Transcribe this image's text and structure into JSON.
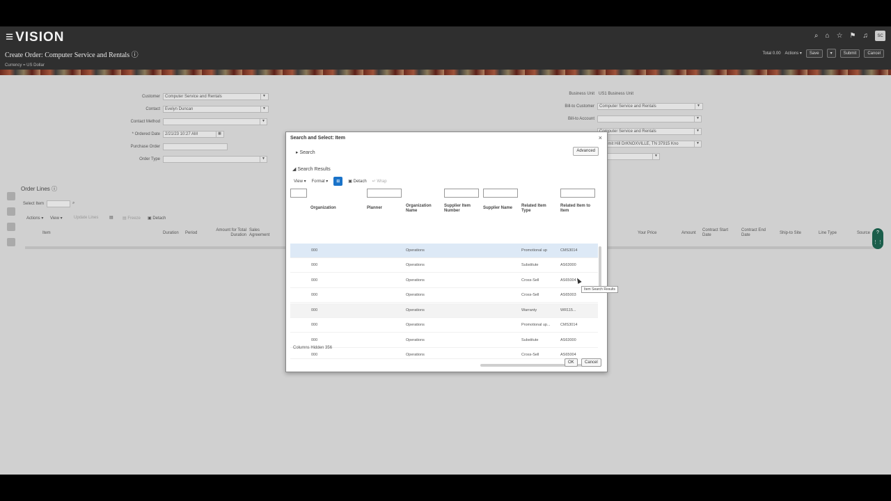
{
  "brand": "VISION",
  "page_title": "Create Order: Computer Service and Rentals",
  "currency": "Currency = US Dollar",
  "header": {
    "total": "Total 0.00",
    "actions": "Actions",
    "save": "Save",
    "submit": "Submit",
    "cancel": "Cancel",
    "avatar": "SC"
  },
  "form_left": {
    "customer_label": "Customer",
    "customer_value": "Computer Service and Rentals",
    "contact_label": "Contact",
    "contact_value": "Evelyn Duncan",
    "contact_method_label": "Contact Method",
    "ordered_date_label": "* Ordered Date",
    "ordered_date_value": "2/21/23 10:27 AM",
    "purchase_order_label": "Purchase Order",
    "order_type_label": "Order Type"
  },
  "form_right": {
    "business_unit_label": "Business Unit",
    "business_unit_value": "US1 Business Unit",
    "bill_to_customer_label": "Bill-to Customer",
    "bill_to_customer_value": "Computer Service and Rentals",
    "bill_to_account_label": "Bill-to Account",
    "ship_to_customer_value": "Computer Service and Rentals",
    "ship_to_address_value": "Summit Hill DrKNOXVILLE, TN 37915 Kno"
  },
  "order_lines": {
    "title": "Order Lines",
    "select_item": "Select Item",
    "actions": "Actions",
    "view": "View",
    "update_lines": "Update Lines",
    "freeze": "Freeze",
    "detach": "Detach",
    "columns": [
      "Item",
      "Duration",
      "Period",
      "Amount for Total Duration",
      "Sales Agreement",
      "Your Price",
      "Amount",
      "Contract Start Date",
      "Contract End Date",
      "Ship-to Site",
      "Line Type",
      "Source"
    ]
  },
  "modal": {
    "title": "Search and Select: Item",
    "search": "Search",
    "advanced": "Advanced",
    "search_results": "Search Results",
    "view": "View",
    "format": "Format",
    "detach": "Detach",
    "wrap": "Wrap",
    "columns": [
      "Organization",
      "Planner",
      "Organization Name",
      "Supplier Item Number",
      "Supplier Name",
      "Related Item Type",
      "Related Item to Item"
    ],
    "rows": [
      {
        "org": "000",
        "org_name": "Operations",
        "type": "Promotional up",
        "item": "CMS3014"
      },
      {
        "org": "000",
        "org_name": "Operations",
        "type": "Substitute",
        "item": "AS63000"
      },
      {
        "org": "000",
        "org_name": "Operations",
        "type": "Cross-Sell",
        "item": "AS65004"
      },
      {
        "org": "000",
        "org_name": "Operations",
        "type": "Cross-Sell",
        "item": "AS65003"
      },
      {
        "org": "000",
        "org_name": "Operations",
        "type": "Warranty",
        "item": "WR115..."
      },
      {
        "org": "000",
        "org_name": "Operations",
        "type": "Promotional up...",
        "item": "CMS3014"
      },
      {
        "org": "000",
        "org_name": "Operations",
        "type": "Substitute",
        "item": "AS63000"
      },
      {
        "org": "000",
        "org_name": "Operations",
        "type": "Cross-Sell",
        "item": "AS65004"
      }
    ],
    "columns_hidden": "Columns Hidden  356",
    "ok": "OK",
    "cancel": "Cancel",
    "tooltip": "Item Search Results"
  }
}
